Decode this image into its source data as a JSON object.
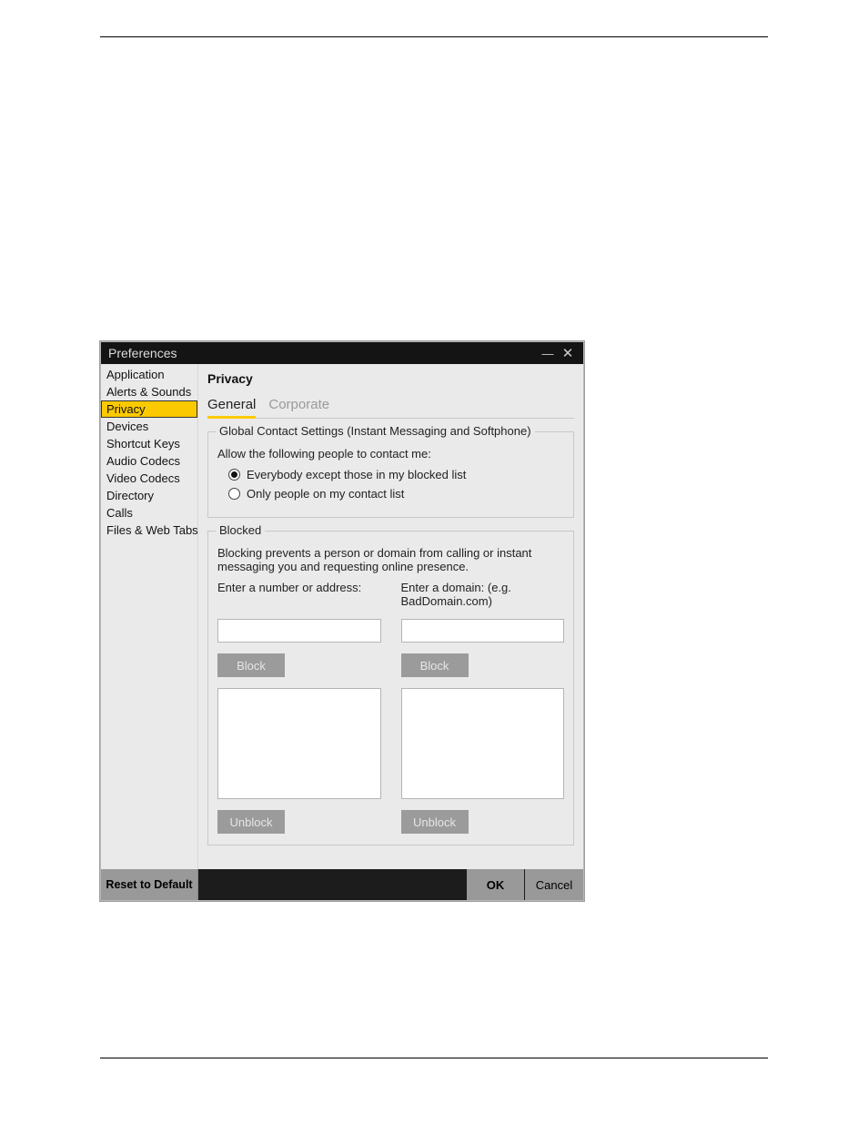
{
  "window": {
    "title": "Preferences"
  },
  "sidebar": {
    "items": [
      {
        "label": "Application"
      },
      {
        "label": "Alerts & Sounds"
      },
      {
        "label": "Privacy",
        "selected": true
      },
      {
        "label": "Devices"
      },
      {
        "label": "Shortcut Keys"
      },
      {
        "label": "Audio Codecs"
      },
      {
        "label": "Video Codecs"
      },
      {
        "label": "Directory"
      },
      {
        "label": "Calls"
      },
      {
        "label": "Files & Web Tabs"
      }
    ]
  },
  "main": {
    "heading": "Privacy",
    "tabs": [
      {
        "label": "General",
        "active": true
      },
      {
        "label": "Corporate"
      }
    ],
    "global": {
      "legend": "Global Contact Settings (Instant Messaging and Softphone)",
      "prompt": "Allow the following people to contact me:",
      "options": [
        {
          "label": "Everybody except those in my blocked list",
          "checked": true
        },
        {
          "label": "Only people on my contact list",
          "checked": false
        }
      ]
    },
    "blocked": {
      "legend": "Blocked",
      "desc": "Blocking prevents a person or domain from calling or instant messaging you and requesting online presence.",
      "address": {
        "label": "Enter a number or address:",
        "block_btn": "Block",
        "unblock_btn": "Unblock"
      },
      "domain": {
        "label": "Enter a domain: (e.g. BadDomain.com)",
        "block_btn": "Block",
        "unblock_btn": "Unblock"
      }
    }
  },
  "footer": {
    "reset": "Reset to Default",
    "ok": "OK",
    "cancel": "Cancel"
  }
}
